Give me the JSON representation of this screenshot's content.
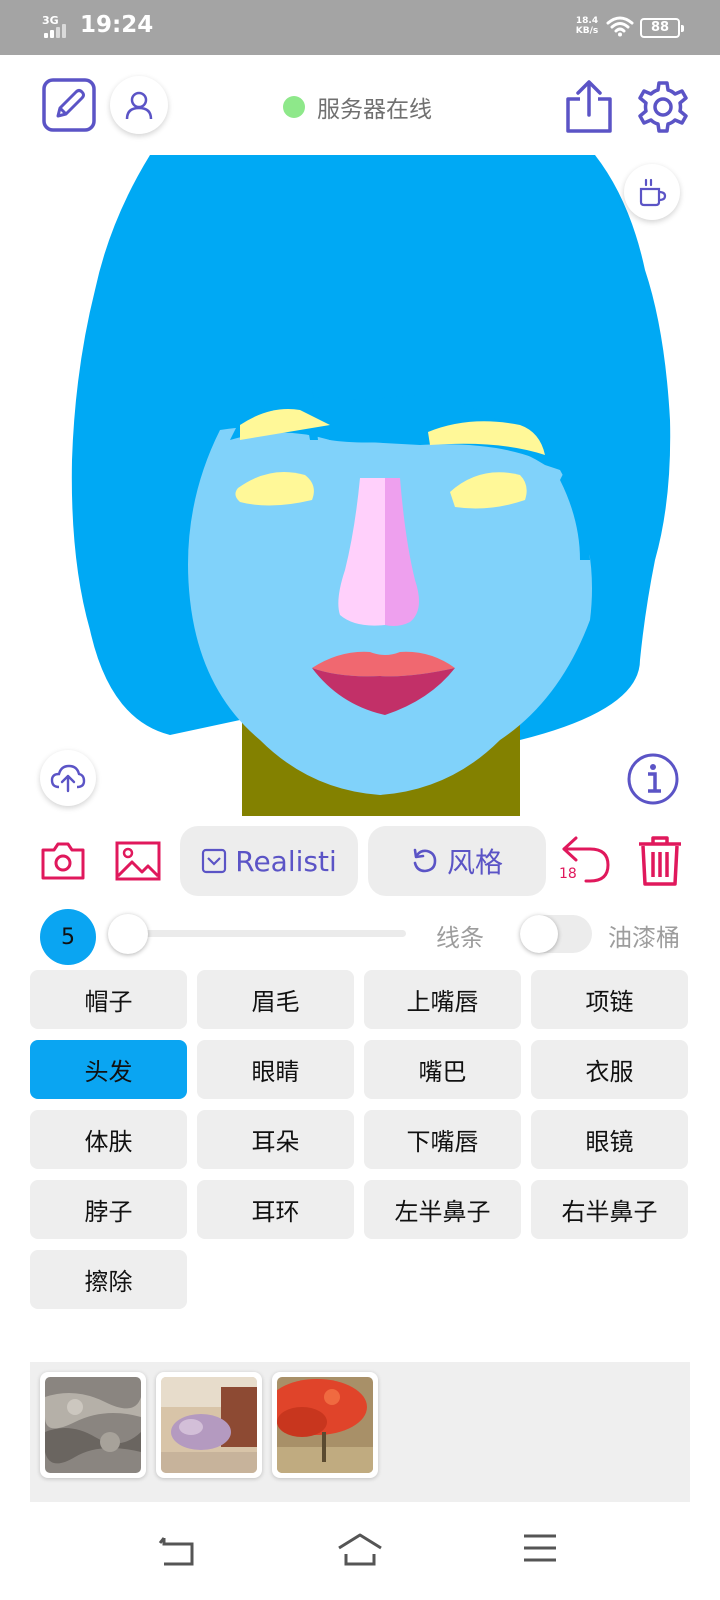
{
  "status_bar": {
    "network": "3G",
    "time": "19:24",
    "speed_value": "18.4",
    "speed_unit": "KB/s",
    "battery": "88"
  },
  "header": {
    "server_status": "服务器在线",
    "server_status_color": "#8ee88a"
  },
  "toolbar": {
    "style_select": "Realisti",
    "style_button": "风格",
    "undo_count": "18"
  },
  "brush": {
    "size": "5",
    "line_label": "线条",
    "bucket_label": "油漆桶",
    "bucket_enabled": false
  },
  "categories": [
    {
      "label": "帽子",
      "active": false
    },
    {
      "label": "眉毛",
      "active": false
    },
    {
      "label": "上嘴唇",
      "active": false
    },
    {
      "label": "项链",
      "active": false
    },
    {
      "label": "头发",
      "active": true
    },
    {
      "label": "眼睛",
      "active": false
    },
    {
      "label": "嘴巴",
      "active": false
    },
    {
      "label": "衣服",
      "active": false
    },
    {
      "label": "体肤",
      "active": false
    },
    {
      "label": "耳朵",
      "active": false
    },
    {
      "label": "下嘴唇",
      "active": false
    },
    {
      "label": "眼镜",
      "active": false
    },
    {
      "label": "脖子",
      "active": false
    },
    {
      "label": "耳环",
      "active": false
    },
    {
      "label": "左半鼻子",
      "active": false
    },
    {
      "label": "右半鼻子",
      "active": false
    },
    {
      "label": "擦除",
      "active": false
    }
  ],
  "colors": {
    "accent": "#5b54c6",
    "danger": "#e0185c",
    "active": "#0aa5f2",
    "hair": "#00a9f4",
    "skin": "#80d2fa",
    "eyes": "#fff898",
    "nose_left": "#ffd0fb",
    "nose_right": "#eea0ee",
    "upper_lip": "#f06870",
    "lower_lip": "#c23068",
    "neck": "#838100"
  },
  "style_thumbnails": [
    "style-thumbnail-grey",
    "style-thumbnail-floral",
    "style-thumbnail-red"
  ]
}
